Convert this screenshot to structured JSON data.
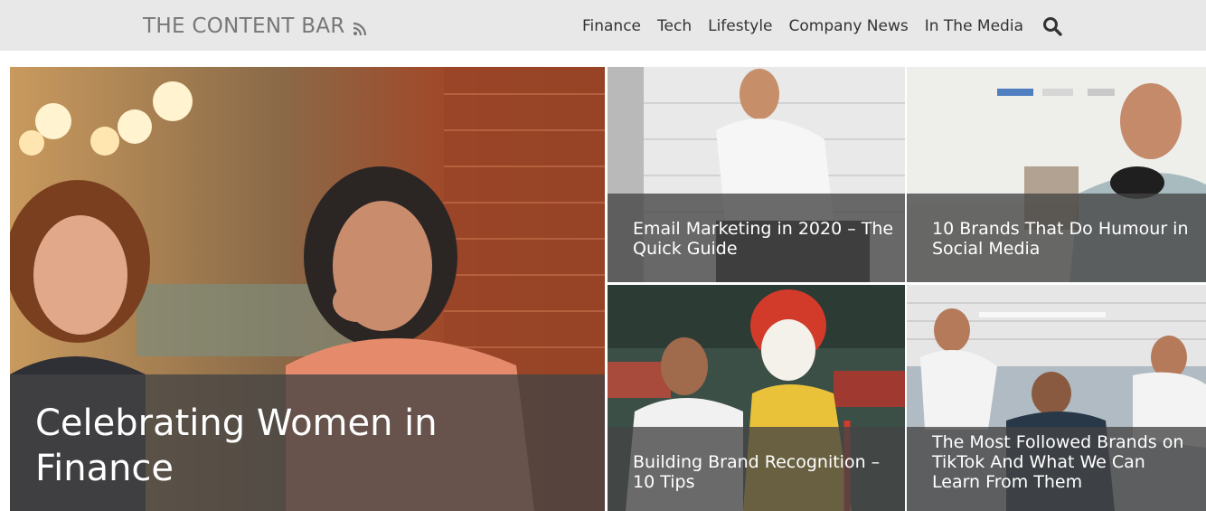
{
  "header": {
    "site_title": "THE CONTENT BAR",
    "rss_icon": "rss-icon",
    "nav": [
      {
        "label": "Finance"
      },
      {
        "label": "Tech"
      },
      {
        "label": "Lifestyle"
      },
      {
        "label": "Company News"
      },
      {
        "label": "In The Media"
      }
    ],
    "search_icon": "search-icon"
  },
  "posts": {
    "featured": {
      "title": "Celebrating Women in Finance"
    },
    "items": [
      {
        "title": "Email Marketing in 2020 – The Quick Guide"
      },
      {
        "title": "10 Brands That Do Humour in Social Media"
      },
      {
        "title": "Building Brand Recognition – 10 Tips"
      },
      {
        "title": "The Most Followed Brands on TikTok And What We Can Learn From Them"
      }
    ]
  },
  "colors": {
    "header_bg": "#e8e8e8",
    "overlay": "#444444",
    "nav_text": "#333333",
    "logo_text": "#777777"
  }
}
